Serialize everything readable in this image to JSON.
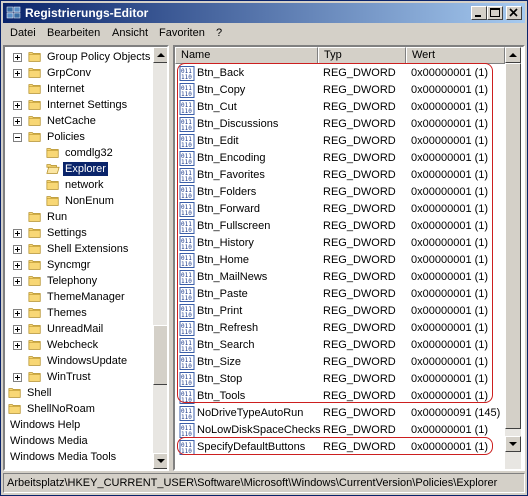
{
  "window": {
    "title": "Registrierungs-Editor"
  },
  "menu": [
    "Datei",
    "Bearbeiten",
    "Ansicht",
    "Favoriten",
    "?"
  ],
  "tree": [
    {
      "label": "Group Policy Objects",
      "level": 1,
      "expander": "plus"
    },
    {
      "label": "GrpConv",
      "level": 1,
      "expander": "plus"
    },
    {
      "label": "Internet",
      "level": 1,
      "expander": "none"
    },
    {
      "label": "Internet Settings",
      "level": 1,
      "expander": "plus"
    },
    {
      "label": "NetCache",
      "level": 1,
      "expander": "plus"
    },
    {
      "label": "Policies",
      "level": 1,
      "expander": "minus"
    },
    {
      "label": "comdlg32",
      "level": 2,
      "expander": "none"
    },
    {
      "label": "Explorer",
      "level": 2,
      "expander": "none",
      "selected": true
    },
    {
      "label": "network",
      "level": 2,
      "expander": "none"
    },
    {
      "label": "NonEnum",
      "level": 2,
      "expander": "none"
    },
    {
      "label": "Run",
      "level": 1,
      "expander": "none"
    },
    {
      "label": "Settings",
      "level": 1,
      "expander": "plus"
    },
    {
      "label": "Shell Extensions",
      "level": 1,
      "expander": "plus"
    },
    {
      "label": "Syncmgr",
      "level": 1,
      "expander": "plus"
    },
    {
      "label": "Telephony",
      "level": 1,
      "expander": "plus"
    },
    {
      "label": "ThemeManager",
      "level": 1,
      "expander": "none"
    },
    {
      "label": "Themes",
      "level": 1,
      "expander": "plus"
    },
    {
      "label": "UnreadMail",
      "level": 1,
      "expander": "plus"
    },
    {
      "label": "Webcheck",
      "level": 1,
      "expander": "plus"
    },
    {
      "label": "WindowsUpdate",
      "level": 1,
      "expander": "none"
    },
    {
      "label": "WinTrust",
      "level": 1,
      "expander": "plus"
    },
    {
      "label": "Shell",
      "level": 0,
      "expander": "none"
    },
    {
      "label": "ShellNoRoam",
      "level": 0,
      "expander": "none"
    },
    {
      "label": "Windows Help",
      "level": 0,
      "expander": "none",
      "nofolder": true
    },
    {
      "label": "Windows Media",
      "level": 0,
      "expander": "none",
      "nofolder": true
    },
    {
      "label": "Windows Media Tools",
      "level": 0,
      "expander": "none",
      "nofolder": true
    }
  ],
  "columns": {
    "name": "Name",
    "type": "Typ",
    "value": "Wert"
  },
  "values": [
    {
      "name": "Btn_Back",
      "type": "REG_DWORD",
      "value": "0x00000001 (1)"
    },
    {
      "name": "Btn_Copy",
      "type": "REG_DWORD",
      "value": "0x00000001 (1)"
    },
    {
      "name": "Btn_Cut",
      "type": "REG_DWORD",
      "value": "0x00000001 (1)"
    },
    {
      "name": "Btn_Discussions",
      "type": "REG_DWORD",
      "value": "0x00000001 (1)"
    },
    {
      "name": "Btn_Edit",
      "type": "REG_DWORD",
      "value": "0x00000001 (1)"
    },
    {
      "name": "Btn_Encoding",
      "type": "REG_DWORD",
      "value": "0x00000001 (1)"
    },
    {
      "name": "Btn_Favorites",
      "type": "REG_DWORD",
      "value": "0x00000001 (1)"
    },
    {
      "name": "Btn_Folders",
      "type": "REG_DWORD",
      "value": "0x00000001 (1)"
    },
    {
      "name": "Btn_Forward",
      "type": "REG_DWORD",
      "value": "0x00000001 (1)"
    },
    {
      "name": "Btn_Fullscreen",
      "type": "REG_DWORD",
      "value": "0x00000001 (1)"
    },
    {
      "name": "Btn_History",
      "type": "REG_DWORD",
      "value": "0x00000001 (1)"
    },
    {
      "name": "Btn_Home",
      "type": "REG_DWORD",
      "value": "0x00000001 (1)"
    },
    {
      "name": "Btn_MailNews",
      "type": "REG_DWORD",
      "value": "0x00000001 (1)"
    },
    {
      "name": "Btn_Paste",
      "type": "REG_DWORD",
      "value": "0x00000001 (1)"
    },
    {
      "name": "Btn_Print",
      "type": "REG_DWORD",
      "value": "0x00000001 (1)"
    },
    {
      "name": "Btn_Refresh",
      "type": "REG_DWORD",
      "value": "0x00000001 (1)"
    },
    {
      "name": "Btn_Search",
      "type": "REG_DWORD",
      "value": "0x00000001 (1)"
    },
    {
      "name": "Btn_Size",
      "type": "REG_DWORD",
      "value": "0x00000001 (1)"
    },
    {
      "name": "Btn_Stop",
      "type": "REG_DWORD",
      "value": "0x00000001 (1)"
    },
    {
      "name": "Btn_Tools",
      "type": "REG_DWORD",
      "value": "0x00000001 (1)"
    },
    {
      "name": "NoDriveTypeAutoRun",
      "type": "REG_DWORD",
      "value": "0x00000091 (145)"
    },
    {
      "name": "NoLowDiskSpaceChecks",
      "type": "REG_DWORD",
      "value": "0x00000001 (1)"
    },
    {
      "name": "SpecifyDefaultButtons",
      "type": "REG_DWORD",
      "value": "0x00000001 (1)"
    }
  ],
  "highlight_color": "#cc1f1f",
  "status": "Arbeitsplatz\\HKEY_CURRENT_USER\\Software\\Microsoft\\Windows\\CurrentVersion\\Policies\\Explorer"
}
